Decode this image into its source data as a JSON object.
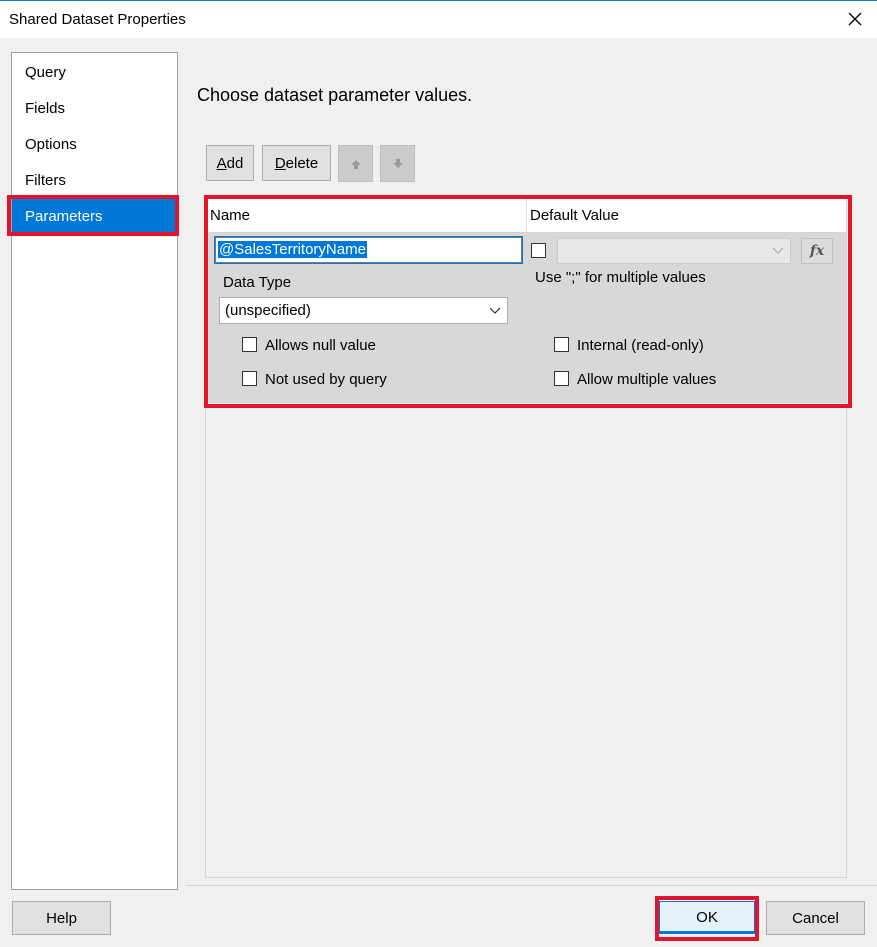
{
  "window": {
    "title": "Shared Dataset Properties"
  },
  "nav": {
    "items": [
      {
        "label": "Query"
      },
      {
        "label": "Fields"
      },
      {
        "label": "Options"
      },
      {
        "label": "Filters"
      },
      {
        "label": "Parameters",
        "selected": true
      }
    ]
  },
  "main": {
    "heading": "Choose dataset parameter values.",
    "toolbar": {
      "add_mnemonic": "A",
      "add_rest": "dd",
      "delete_mnemonic": "D",
      "delete_rest": "elete"
    },
    "grid": {
      "col_name": "Name",
      "col_default": "Default Value",
      "row": {
        "name_value": "@SalesTerritoryName",
        "data_type_label": "Data Type",
        "data_type_value": "(unspecified)",
        "multi_hint": "Use \";\" for multiple values",
        "allows_null_label": "Allows null value",
        "not_used_label": "Not used by query",
        "internal_label": "Internal (read-only)",
        "allow_multiple_label": "Allow multiple values",
        "fx_label": "fx"
      }
    }
  },
  "footer": {
    "help": "Help",
    "ok": "OK",
    "cancel": "Cancel"
  },
  "colors": {
    "accent": "#0078d7",
    "highlight": "#e0142a"
  }
}
